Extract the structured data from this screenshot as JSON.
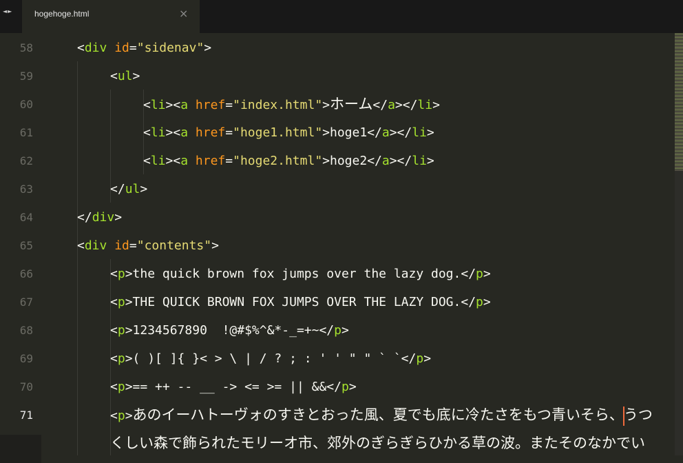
{
  "tab": {
    "nav_arrows": "◄►",
    "filename": "hogehoge.html",
    "close_glyph": "×"
  },
  "line_numbers": [
    "58",
    "59",
    "60",
    "61",
    "62",
    "63",
    "64",
    "65",
    "66",
    "67",
    "68",
    "69",
    "70",
    "71"
  ],
  "current_line": "71",
  "code": {
    "l58": {
      "tag": "div",
      "attr": "id",
      "value": "\"sidenav\""
    },
    "l59": {
      "tag": "ul"
    },
    "l60": {
      "attr": "href",
      "value": "\"index.html\"",
      "text": "ホーム"
    },
    "l61": {
      "attr": "href",
      "value": "\"hoge1.html\"",
      "text": "hoge1"
    },
    "l62": {
      "attr": "href",
      "value": "\"hoge2.html\"",
      "text": "hoge2"
    },
    "l63": {
      "tag": "ul"
    },
    "l64": {
      "tag": "div"
    },
    "l65": {
      "tag": "div",
      "attr": "id",
      "value": "\"contents\""
    },
    "l66": {
      "tag": "p",
      "text": "the quick brown fox jumps over the lazy dog."
    },
    "l67": {
      "tag": "p",
      "text": "THE QUICK BROWN FOX JUMPS OVER THE LAZY DOG."
    },
    "l68": {
      "tag": "p",
      "text": "1234567890  !@#$%^&*-_=+~"
    },
    "l69": {
      "tag": "p",
      "text": "( )[ ]{ }< > \\ | / ? ; : ' ' \" \" ` `"
    },
    "l70": {
      "tag": "p",
      "text": "== ++ -- __ -> <= >= || &&"
    },
    "l71": {
      "tag": "p",
      "text_before_cursor": "あのイーハトーヴォのすきとおった風、夏でも底に冷たさをもつ青いそら、",
      "text_after_cursor": "うつ",
      "wrap": "くしい森で飾られたモリーオ市、郊外のぎらぎらひかる草の波。またそのなかでい"
    }
  },
  "colors": {
    "background": "#272822",
    "tag": "#a6e22e",
    "attribute": "#fd971f",
    "string": "#e6db74",
    "text": "#f8f8f2",
    "cursor": "#f06a3c"
  }
}
